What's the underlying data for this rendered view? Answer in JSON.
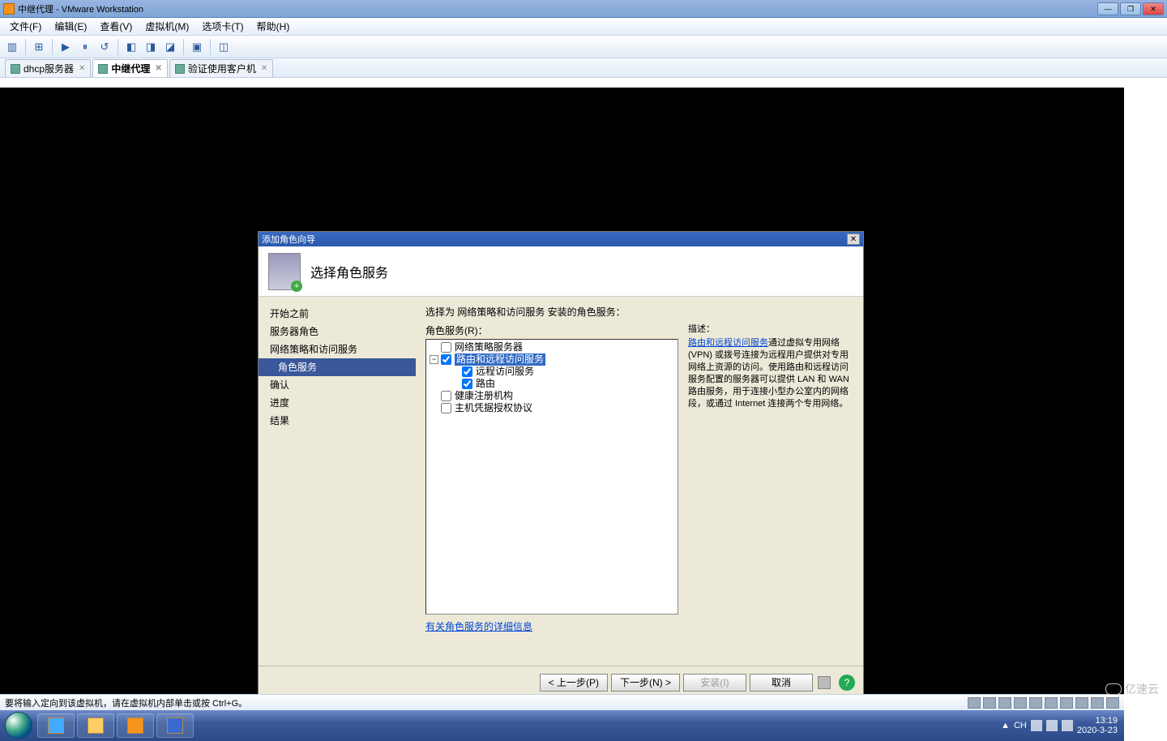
{
  "outer_window": {
    "title": "中继代理 - VMware Workstation",
    "btn_min": "—",
    "btn_max": "❐",
    "btn_close": "✕"
  },
  "menubar": {
    "file": "文件(F)",
    "edit": "编辑(E)",
    "view": "查看(V)",
    "vm": "虚拟机(M)",
    "tabs": "选项卡(T)",
    "help": "帮助(H)"
  },
  "vm_tabs": {
    "t0": "dhcp服务器",
    "t1": "中继代理",
    "t2": "验证使用客户机"
  },
  "wizard": {
    "title": "添加角色向导",
    "header": "选择角色服务",
    "nav": {
      "n0": "开始之前",
      "n1": "服务器角色",
      "n2": "网络策略和访问服务",
      "n3": "角色服务",
      "n4": "确认",
      "n5": "进度",
      "n6": "结果"
    },
    "prompt": "选择为 网络策略和访问服务 安装的角色服务：",
    "role_label": "角色服务(R)：",
    "tree": {
      "r0": "网络策略服务器",
      "r1": "路由和远程访问服务",
      "r1a": "远程访问服务",
      "r1b": "路由",
      "r2": "健康注册机构",
      "r3": "主机凭据授权协议"
    },
    "desc_label": "描述：",
    "desc_link": "路由和远程访问服务",
    "desc_text": "通过虚拟专用网络 (VPN) 或拨号连接为远程用户提供对专用网络上资源的访问。使用路由和远程访问服务配置的服务器可以提供 LAN 和 WAN 路由服务，用于连接小型办公室内的网络段，或通过 Internet 连接两个专用网络。",
    "more_link": "有关角色服务的详细信息",
    "btn_prev": "< 上一步(P)",
    "btn_next": "下一步(N) >",
    "btn_install": "安装(I)",
    "btn_cancel": "取消"
  },
  "inner_taskbar": {
    "start": "开始",
    "task0": "服务器管理器",
    "clock": "13:19"
  },
  "outer_status": {
    "text": "要将输入定向到该虚拟机，请在虚拟机内部单击或按 Ctrl+G。"
  },
  "host_taskbar": {
    "lang": "CH",
    "time": "13:19",
    "date": "2020-3-23"
  },
  "watermark": "亿速云"
}
